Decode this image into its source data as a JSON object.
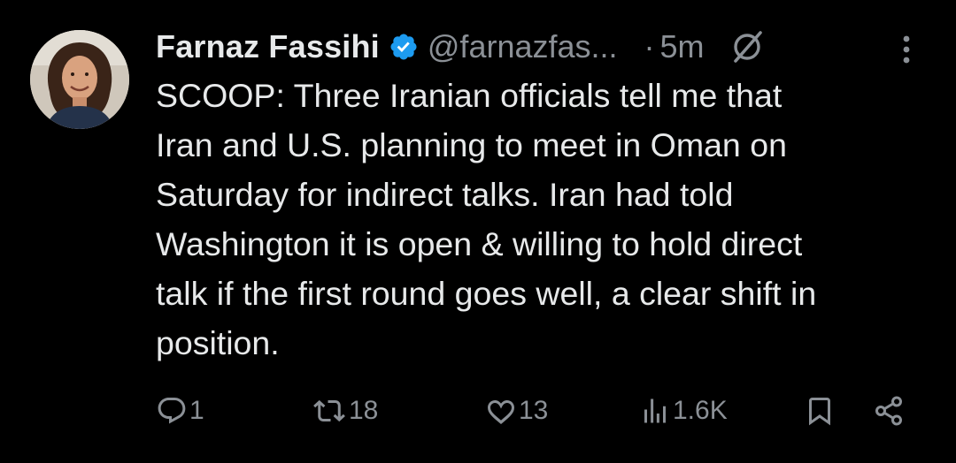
{
  "tweet": {
    "display_name": "Farnaz Fassihi",
    "handle": "@farnazfas...",
    "separator": "·",
    "time": "5m",
    "text": "SCOOP: Three Iranian officials tell me that\nIran and U.S. planning to meet in Oman on\nSaturday for indirect talks. Iran had told\nWashington it is open & willing to hold direct\ntalk if the first round goes well, a clear shift in\nposition.",
    "avatar_icon": "avatar-photo",
    "verified_icon": "verified-badge-icon",
    "grok_icon": "grok-icon",
    "more_icon": "more-vertical-icon"
  },
  "actions": {
    "reply": {
      "icon": "reply-icon",
      "count": "1"
    },
    "repost": {
      "icon": "repost-icon",
      "count": "18"
    },
    "like": {
      "icon": "heart-icon",
      "count": "13"
    },
    "views": {
      "icon": "views-icon",
      "count": "1.6K"
    },
    "bookmark": {
      "icon": "bookmark-icon"
    },
    "share": {
      "icon": "share-icon"
    }
  },
  "colors": {
    "background": "#000000",
    "text": "#e7e9ea",
    "secondary": "#8b9096",
    "verified": "#1d9bf0"
  }
}
